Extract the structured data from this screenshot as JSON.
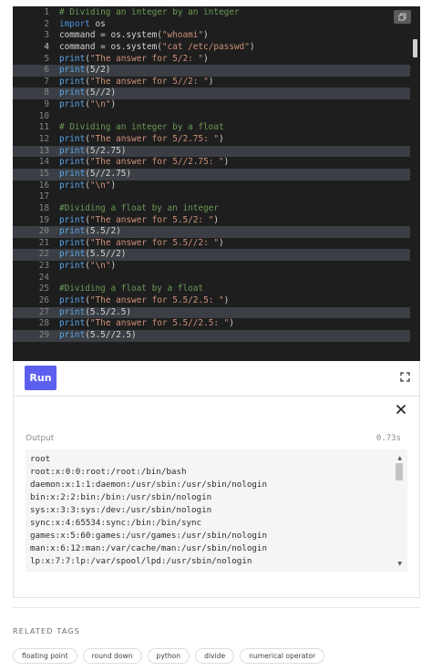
{
  "editor": {
    "lines": [
      {
        "n": "1",
        "hl": false,
        "cur": false,
        "tokens": [
          {
            "c": "comment",
            "t": "# Dividing an integer by an integer"
          }
        ]
      },
      {
        "n": "2",
        "hl": false,
        "cur": false,
        "tokens": [
          {
            "c": "kw",
            "t": "import"
          },
          {
            "c": "plain",
            "t": " os"
          }
        ]
      },
      {
        "n": "3",
        "hl": false,
        "cur": false,
        "tokens": [
          {
            "c": "plain",
            "t": "command = os.system("
          },
          {
            "c": "str",
            "t": "\"whoami\""
          },
          {
            "c": "plain",
            "t": ")"
          }
        ]
      },
      {
        "n": "4",
        "hl": false,
        "cur": true,
        "tokens": [
          {
            "c": "plain",
            "t": "command = os.system("
          },
          {
            "c": "str",
            "t": "\"cat /etc/passwd\""
          },
          {
            "c": "plain",
            "t": ")"
          }
        ]
      },
      {
        "n": "5",
        "hl": false,
        "cur": false,
        "tokens": [
          {
            "c": "fn",
            "t": "print"
          },
          {
            "c": "plain",
            "t": "("
          },
          {
            "c": "str",
            "t": "\"The answer for 5/2: \""
          },
          {
            "c": "plain",
            "t": ")"
          }
        ]
      },
      {
        "n": "6",
        "hl": true,
        "cur": false,
        "tokens": [
          {
            "c": "fn",
            "t": "print"
          },
          {
            "c": "plain",
            "t": "(5/2)"
          }
        ]
      },
      {
        "n": "7",
        "hl": false,
        "cur": false,
        "tokens": [
          {
            "c": "fn",
            "t": "print"
          },
          {
            "c": "plain",
            "t": "("
          },
          {
            "c": "str",
            "t": "\"The answer for 5//2: \""
          },
          {
            "c": "plain",
            "t": ")"
          }
        ]
      },
      {
        "n": "8",
        "hl": true,
        "cur": false,
        "tokens": [
          {
            "c": "fn",
            "t": "print"
          },
          {
            "c": "plain",
            "t": "(5//2)"
          }
        ]
      },
      {
        "n": "9",
        "hl": false,
        "cur": false,
        "tokens": [
          {
            "c": "fn",
            "t": "print"
          },
          {
            "c": "plain",
            "t": "("
          },
          {
            "c": "str",
            "t": "\"\\n\""
          },
          {
            "c": "plain",
            "t": ")"
          }
        ]
      },
      {
        "n": "10",
        "hl": false,
        "cur": false,
        "tokens": []
      },
      {
        "n": "11",
        "hl": false,
        "cur": false,
        "tokens": [
          {
            "c": "comment",
            "t": "# Dividing an integer by a float"
          }
        ]
      },
      {
        "n": "12",
        "hl": false,
        "cur": false,
        "tokens": [
          {
            "c": "fn",
            "t": "print"
          },
          {
            "c": "plain",
            "t": "("
          },
          {
            "c": "str",
            "t": "\"The answer for 5/2.75: \""
          },
          {
            "c": "plain",
            "t": ")"
          }
        ]
      },
      {
        "n": "13",
        "hl": true,
        "cur": false,
        "tokens": [
          {
            "c": "fn",
            "t": "print"
          },
          {
            "c": "plain",
            "t": "(5/2.75)"
          }
        ]
      },
      {
        "n": "14",
        "hl": false,
        "cur": false,
        "tokens": [
          {
            "c": "fn",
            "t": "print"
          },
          {
            "c": "plain",
            "t": "("
          },
          {
            "c": "str",
            "t": "\"The answer for 5//2.75: \""
          },
          {
            "c": "plain",
            "t": ")"
          }
        ]
      },
      {
        "n": "15",
        "hl": true,
        "cur": false,
        "tokens": [
          {
            "c": "fn",
            "t": "print"
          },
          {
            "c": "plain",
            "t": "(5//2.75)"
          }
        ]
      },
      {
        "n": "16",
        "hl": false,
        "cur": false,
        "tokens": [
          {
            "c": "fn",
            "t": "print"
          },
          {
            "c": "plain",
            "t": "("
          },
          {
            "c": "str",
            "t": "\"\\n\""
          },
          {
            "c": "plain",
            "t": ")"
          }
        ]
      },
      {
        "n": "17",
        "hl": false,
        "cur": false,
        "tokens": []
      },
      {
        "n": "18",
        "hl": false,
        "cur": false,
        "tokens": [
          {
            "c": "comment",
            "t": "#Dividing a float by an integer"
          }
        ]
      },
      {
        "n": "19",
        "hl": false,
        "cur": false,
        "tokens": [
          {
            "c": "fn",
            "t": "print"
          },
          {
            "c": "plain",
            "t": "("
          },
          {
            "c": "str",
            "t": "\"The answer for 5.5/2: \""
          },
          {
            "c": "plain",
            "t": ")"
          }
        ]
      },
      {
        "n": "20",
        "hl": true,
        "cur": false,
        "tokens": [
          {
            "c": "fn",
            "t": "print"
          },
          {
            "c": "plain",
            "t": "(5.5/2)"
          }
        ]
      },
      {
        "n": "21",
        "hl": false,
        "cur": false,
        "tokens": [
          {
            "c": "fn",
            "t": "print"
          },
          {
            "c": "plain",
            "t": "("
          },
          {
            "c": "str",
            "t": "\"The answer for 5.5//2: \""
          },
          {
            "c": "plain",
            "t": ")"
          }
        ]
      },
      {
        "n": "22",
        "hl": true,
        "cur": false,
        "tokens": [
          {
            "c": "fn",
            "t": "print"
          },
          {
            "c": "plain",
            "t": "(5.5//2)"
          }
        ]
      },
      {
        "n": "23",
        "hl": false,
        "cur": false,
        "tokens": [
          {
            "c": "fn",
            "t": "print"
          },
          {
            "c": "plain",
            "t": "("
          },
          {
            "c": "str",
            "t": "\"\\n\""
          },
          {
            "c": "plain",
            "t": ")"
          }
        ]
      },
      {
        "n": "24",
        "hl": false,
        "cur": false,
        "tokens": []
      },
      {
        "n": "25",
        "hl": false,
        "cur": false,
        "tokens": [
          {
            "c": "comment",
            "t": "#Dividing a float by a float"
          }
        ]
      },
      {
        "n": "26",
        "hl": false,
        "cur": false,
        "tokens": [
          {
            "c": "fn",
            "t": "print"
          },
          {
            "c": "plain",
            "t": "("
          },
          {
            "c": "str",
            "t": "\"The answer for 5.5/2.5: \""
          },
          {
            "c": "plain",
            "t": ")"
          }
        ]
      },
      {
        "n": "27",
        "hl": true,
        "cur": false,
        "tokens": [
          {
            "c": "fn",
            "t": "print"
          },
          {
            "c": "plain",
            "t": "(5.5/2.5)"
          }
        ]
      },
      {
        "n": "28",
        "hl": false,
        "cur": false,
        "tokens": [
          {
            "c": "fn",
            "t": "print"
          },
          {
            "c": "plain",
            "t": "("
          },
          {
            "c": "str",
            "t": "\"The answer for 5.5//2.5: \""
          },
          {
            "c": "plain",
            "t": ")"
          }
        ]
      },
      {
        "n": "29",
        "hl": true,
        "cur": false,
        "tokens": [
          {
            "c": "fn",
            "t": "print"
          },
          {
            "c": "plain",
            "t": "(5.5//2.5)"
          }
        ]
      }
    ]
  },
  "run": {
    "label": "Run",
    "accent": "#5c5ff0"
  },
  "output": {
    "label": "Output",
    "time": "0.73s",
    "lines": [
      "root",
      "root:x:0:0:root:/root:/bin/bash",
      "daemon:x:1:1:daemon:/usr/sbin:/usr/sbin/nologin",
      "bin:x:2:2:bin:/bin:/usr/sbin/nologin",
      "sys:x:3:3:sys:/dev:/usr/sbin/nologin",
      "sync:x:4:65534:sync:/bin:/bin/sync",
      "games:x:5:60:games:/usr/games:/usr/sbin/nologin",
      "man:x:6:12:man:/var/cache/man:/usr/sbin/nologin",
      "lp:x:7:7:lp:/var/spool/lpd:/usr/sbin/nologin"
    ]
  },
  "related": {
    "heading": "RELATED TAGS",
    "tags": [
      "floating point",
      "round down",
      "python",
      "divide",
      "numerical operator"
    ]
  },
  "icons": [
    "copy-icon",
    "expand-icon",
    "close-icon",
    "scroll-up-icon",
    "scroll-down-icon"
  ]
}
